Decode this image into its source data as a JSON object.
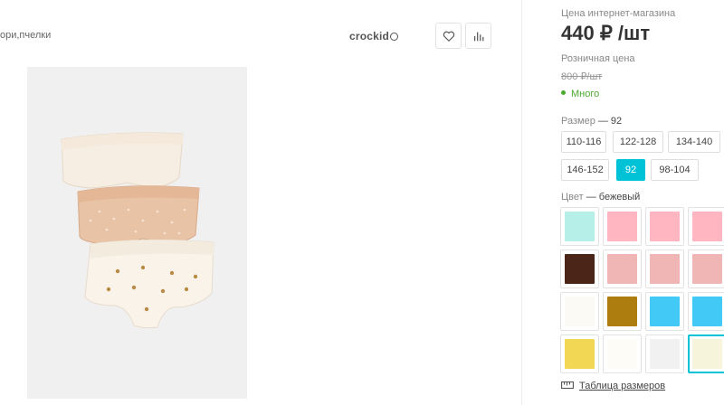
{
  "breadcrumb": "ори,пчелки",
  "brand": "crockid",
  "actions": {
    "favorite_icon": "heart-icon",
    "compare_icon": "bar-chart-icon"
  },
  "pricing": {
    "online_label": "Цена интернет-магазина",
    "online_price": "440 ₽ /шт",
    "retail_label": "Розничная цена",
    "retail_price": "800 ₽/шт",
    "stock": "Много"
  },
  "size": {
    "label": "Размер",
    "selected": "— 92",
    "options": [
      "110-116",
      "122-128",
      "134-140",
      "146-152",
      "92",
      "98-104"
    ],
    "active": "92"
  },
  "color": {
    "label": "Цвет",
    "selected": "— бежевый",
    "swatches": [
      "#b5efe7",
      "#ffb6c1",
      "#ffb6c1",
      "#ffb6c1",
      "#4b2618",
      "#f0b5b5",
      "#f0b5b5",
      "#f0b5b5",
      "#fbfaf5",
      "#ad7d10",
      "#42c9f5",
      "#42c9f5",
      "#f2d754",
      "#fdfcf7",
      "#f1f1f1",
      "#f6f5dc"
    ],
    "selected_index": 15
  },
  "size_table": {
    "icon": "ruler-icon",
    "label": "Таблица размеров"
  },
  "colors": {
    "accent": "#00c2d6",
    "stock_green": "#4caa2e"
  }
}
